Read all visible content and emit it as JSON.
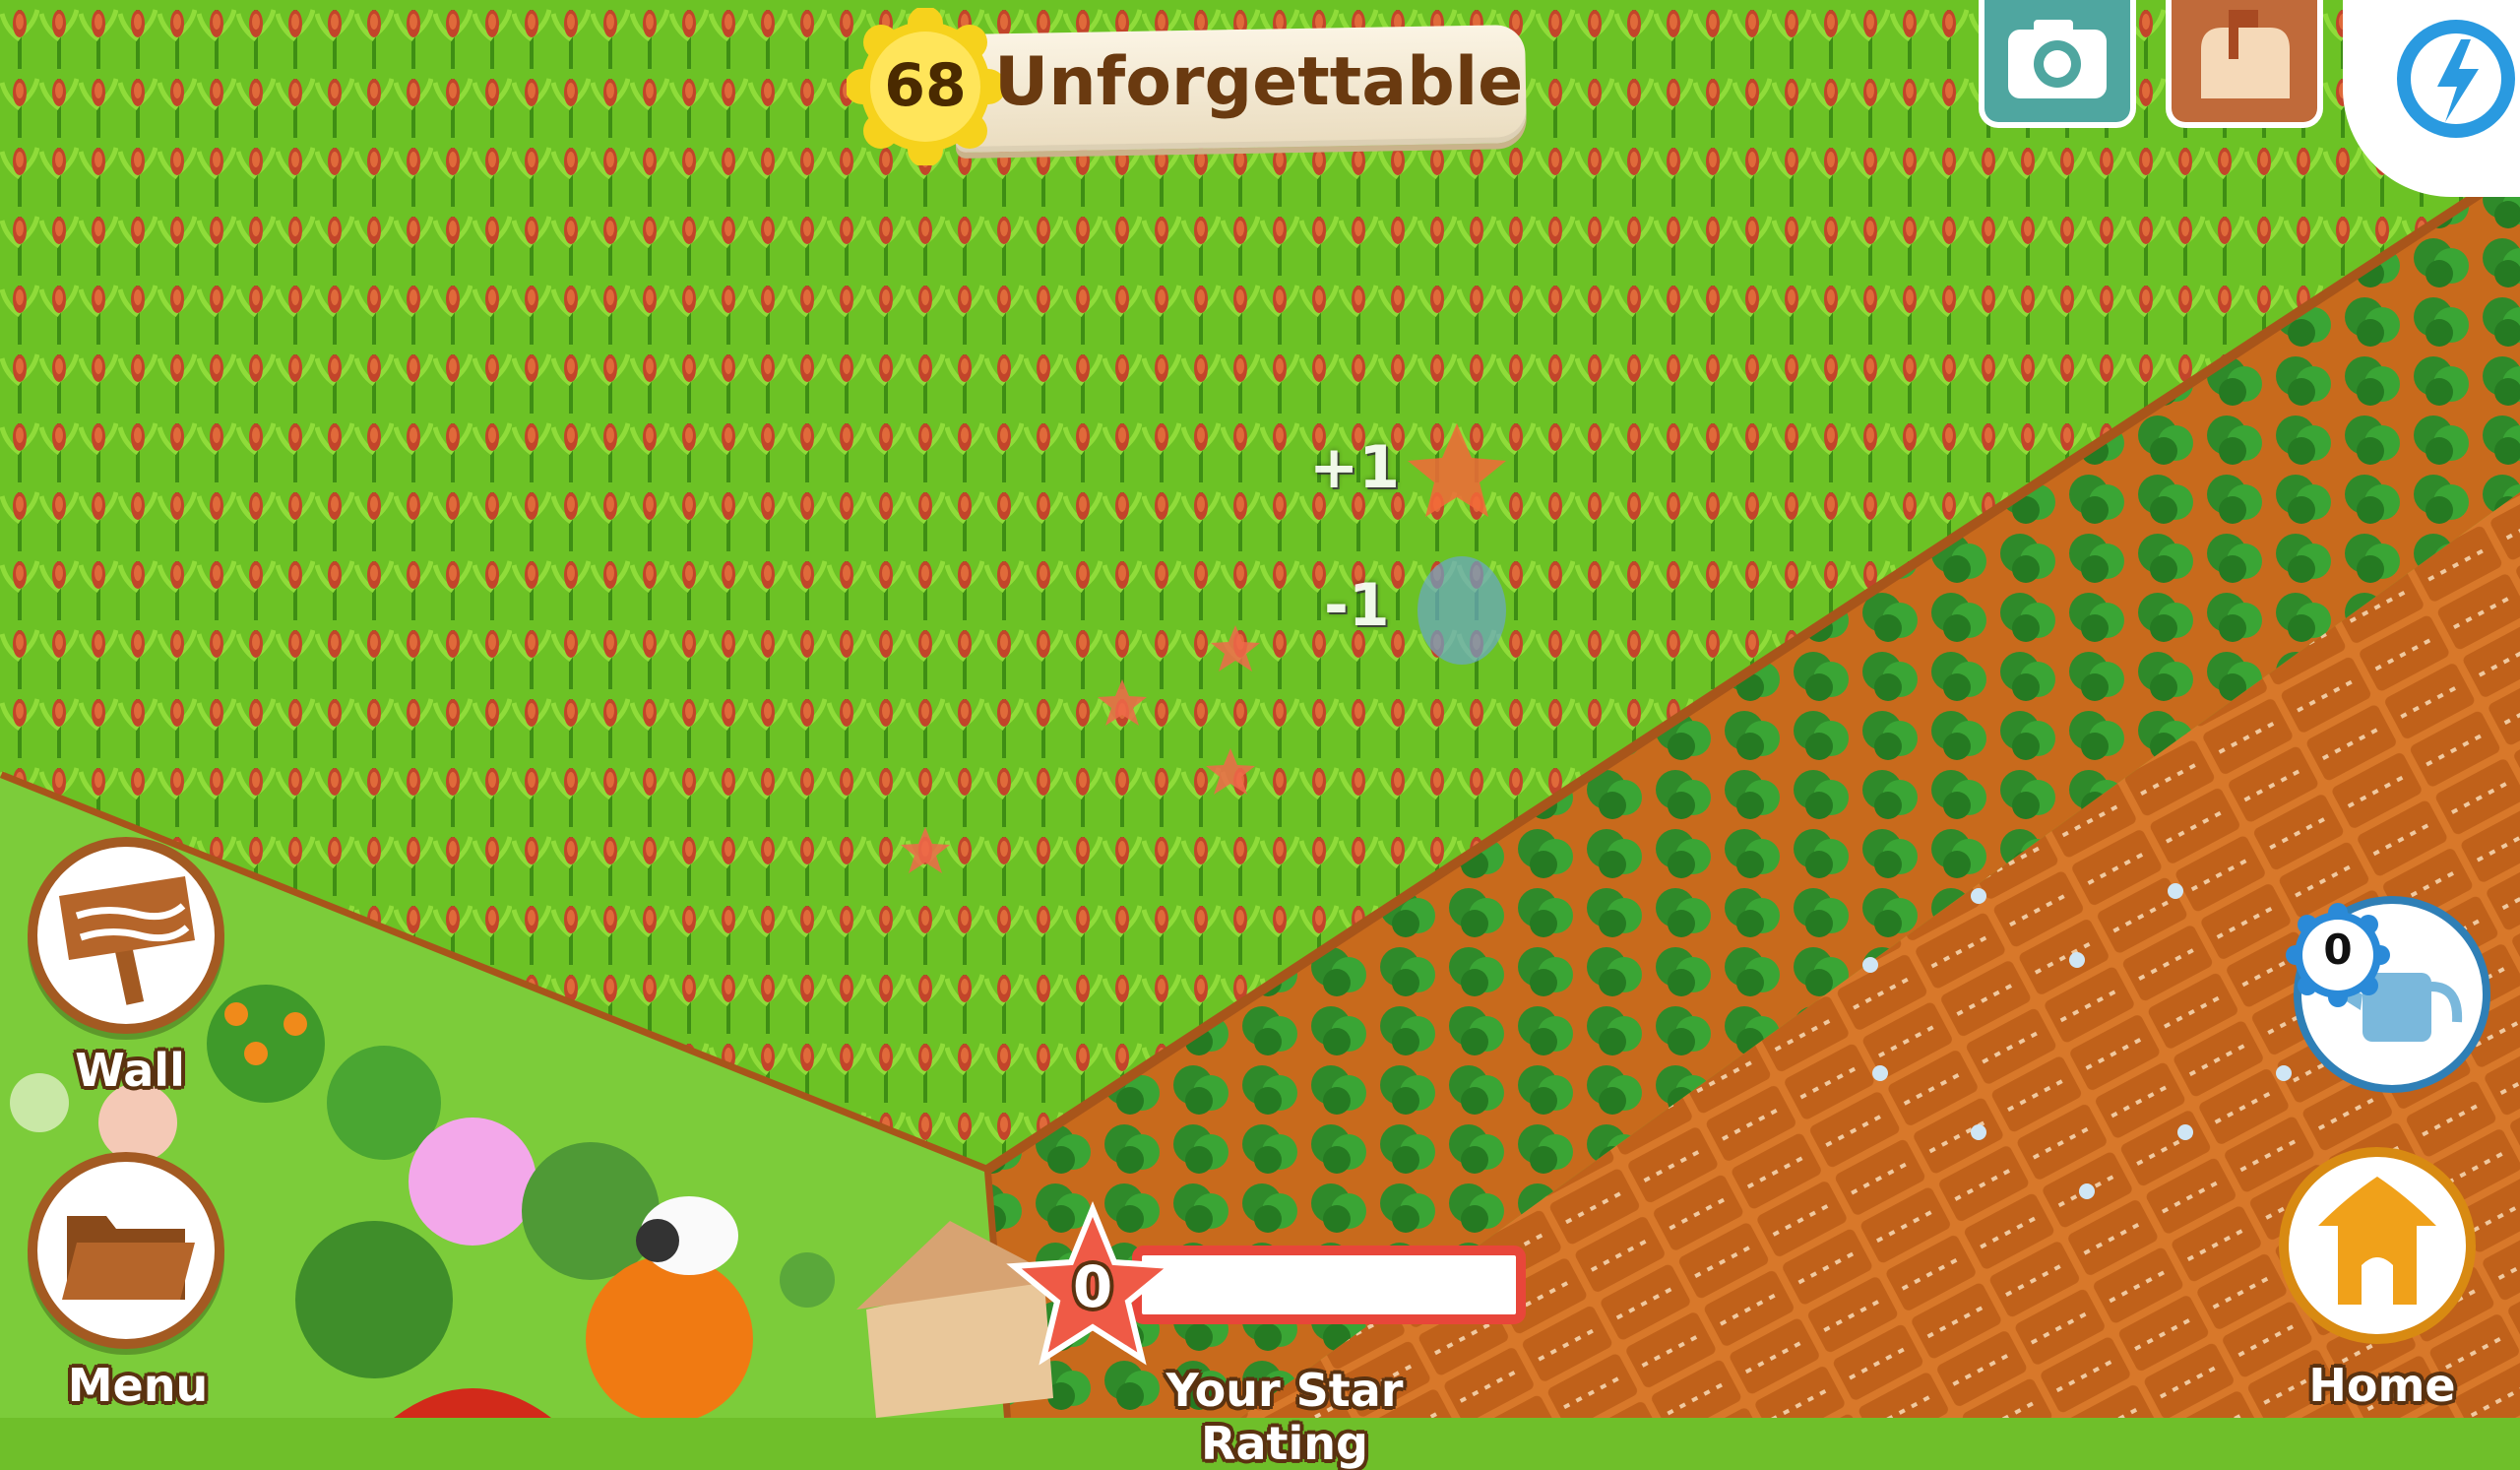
{
  "level": {
    "number": "68",
    "title": "Unforgettable"
  },
  "top_buttons": [
    "camera-icon",
    "mailbox-icon",
    "energy-icon"
  ],
  "left_buttons": {
    "wall_label": "Wall",
    "menu_label": "Menu"
  },
  "right_buttons": {
    "home_label": "Home",
    "watering_can_count": "0"
  },
  "star_rating": {
    "count": "0",
    "label": "Your Star Rating",
    "progress": 0
  },
  "feedback": {
    "xp_gain": "+1",
    "water_loss": "-1"
  },
  "colors": {
    "accent_orange": "#e8463a",
    "wood_brown": "#a35a22",
    "gold": "#f6d21c",
    "grass": "#6fbf2a",
    "soil": "#c96a1e"
  }
}
